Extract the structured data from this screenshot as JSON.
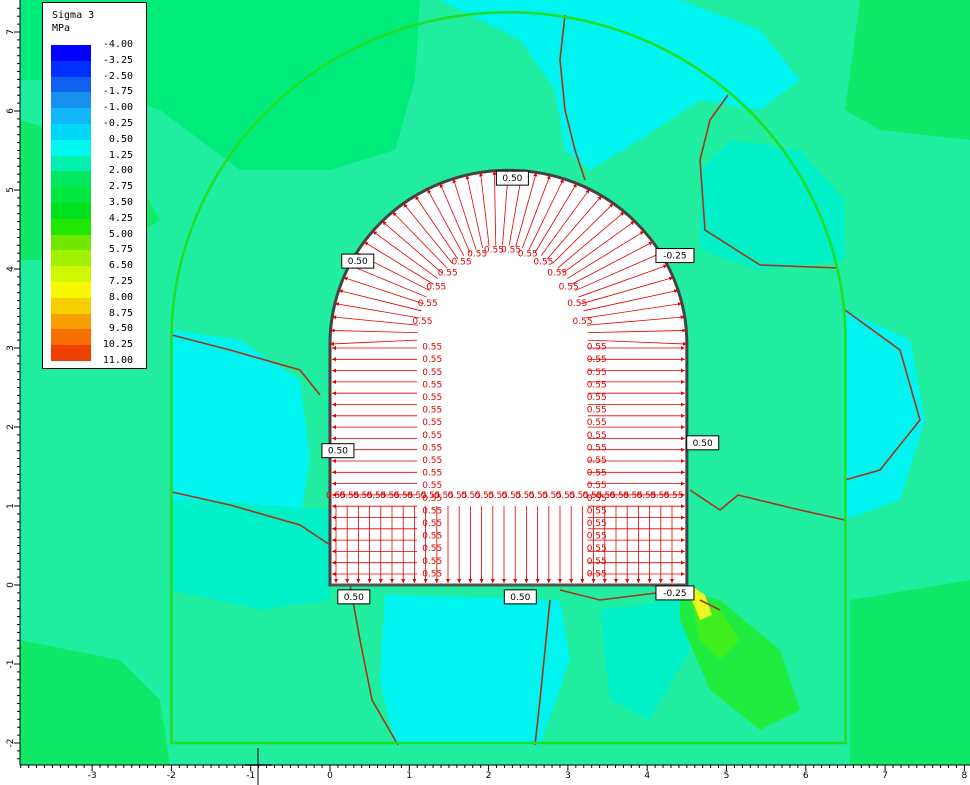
{
  "legend": {
    "title": "Sigma 3",
    "unit": "MPa",
    "levels": [
      {
        "value": "-4.00",
        "color": "#0000ff"
      },
      {
        "value": "-3.25",
        "color": "#0030ff"
      },
      {
        "value": "-2.50",
        "color": "#1060f0"
      },
      {
        "value": "-1.75",
        "color": "#1890f0"
      },
      {
        "value": "-1.00",
        "color": "#10b8f8"
      },
      {
        "value": "-0.25",
        "color": "#00d8f8"
      },
      {
        "value": "0.50",
        "color": "#00f8f0"
      },
      {
        "value": "1.25",
        "color": "#00f0b0"
      },
      {
        "value": "2.00",
        "color": "#00e860"
      },
      {
        "value": "2.75",
        "color": "#00e840"
      },
      {
        "value": "3.50",
        "color": "#00e020"
      },
      {
        "value": "4.25",
        "color": "#20e800"
      },
      {
        "value": "5.00",
        "color": "#70e800"
      },
      {
        "value": "5.75",
        "color": "#a0f000"
      },
      {
        "value": "6.50",
        "color": "#d0f800"
      },
      {
        "value": "7.25",
        "color": "#f8f800"
      },
      {
        "value": "8.00",
        "color": "#f8d000"
      },
      {
        "value": "8.75",
        "color": "#f8a000"
      },
      {
        "value": "9.50",
        "color": "#f87000"
      },
      {
        "value": "10.25",
        "color": "#f04000"
      },
      {
        "value": "11.00",
        "color": "#f00000"
      }
    ]
  },
  "chart_data": {
    "type": "heatmap",
    "title": "Sigma 3",
    "unit": "MPa",
    "xlim": [
      -4,
      8
    ],
    "ylim": [
      -2.2,
      7.3
    ],
    "x_ticks": [
      "-3",
      "-2",
      "-1",
      "0",
      "1",
      "2",
      "3",
      "4",
      "5",
      "6",
      "7",
      "8"
    ],
    "y_ticks": [
      "-2",
      "-1",
      "0",
      "1",
      "2",
      "3",
      "4",
      "5",
      "6",
      "7"
    ],
    "excavation": {
      "floor_y": 0,
      "wall_left_x": 0,
      "wall_right_x": 4.5,
      "wall_top_y": 3.05,
      "crown_y": 5.25
    },
    "outer_boundary": {
      "left_x": -2,
      "right_x": 6.5,
      "floor_y": -2,
      "top_y": 7.25
    },
    "boundary_labels": [
      {
        "text": "0.50",
        "x": 2.3,
        "y": 5.15
      },
      {
        "text": "0.50",
        "x": 0.35,
        "y": 4.1
      },
      {
        "text": "-0.25",
        "x": 4.35,
        "y": 4.17
      },
      {
        "text": "0.50",
        "x": 0.1,
        "y": 1.7
      },
      {
        "text": "0.50",
        "x": 4.7,
        "y": 1.8
      },
      {
        "text": "0.50",
        "x": 0.3,
        "y": -0.15
      },
      {
        "text": "0.50",
        "x": 2.4,
        "y": -0.15
      },
      {
        "text": "-0.25",
        "x": 4.35,
        "y": -0.1
      }
    ],
    "load_value": "0.55",
    "background_color": "#00f0a0"
  }
}
